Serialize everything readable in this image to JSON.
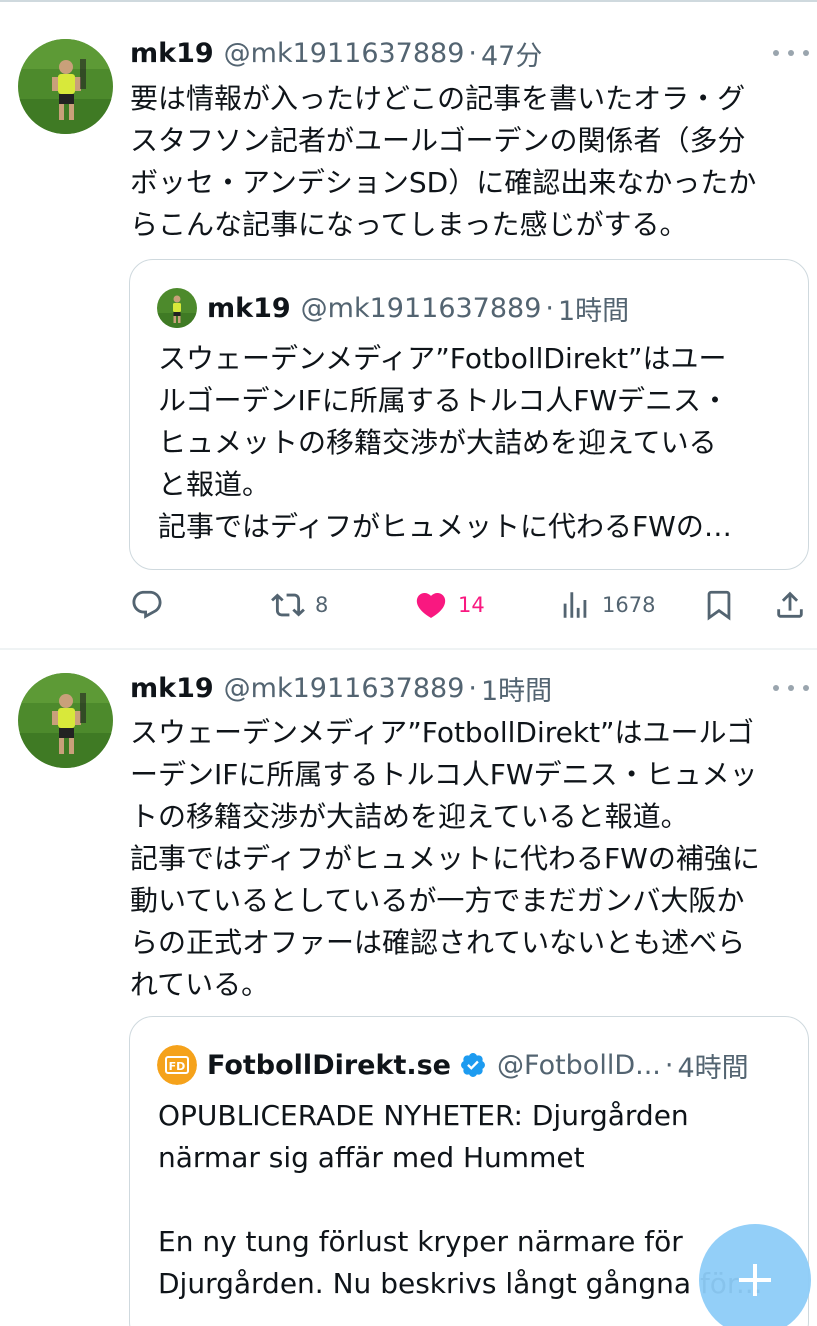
{
  "tweet1": {
    "name": "mk19",
    "handle": "@mk1911637889",
    "dot": "·",
    "time": "47分",
    "text_lines": [
      "要は情報が入ったけどこの記事を書いたオラ・グ",
      "スタフソン記者がユールゴーデンの関係者（多分",
      "ボッセ・アンデションSD）に確認出来なかったか",
      "らこんな記事になってしまった感じがする。"
    ],
    "quote": {
      "name": "mk19",
      "handle": "@mk1911637889",
      "dot": "·",
      "time": "1時間",
      "text_lines": [
        "スウェーデンメディア”FotbollDirekt”はユー",
        "ルゴーデンIFに所属するトルコ人FWデニス・",
        "ヒュメットの移籍交渉が大詰めを迎えている",
        "と報道。",
        "記事ではディフがヒュメットに代わるFWの…"
      ]
    },
    "actions": {
      "replies": "",
      "retweets": "8",
      "likes": "14",
      "views": "1678"
    },
    "like_color": "#f91880"
  },
  "tweet2": {
    "name": "mk19",
    "handle": "@mk1911637889",
    "dot": "·",
    "time": "1時間",
    "text_lines": [
      "スウェーデンメディア”FotbollDirekt”はユールゴ",
      "ーデンIFに所属するトルコ人FWデニス・ヒュメッ",
      "トの移籍交渉が大詰めを迎えていると報道。",
      "記事ではディフがヒュメットに代わるFWの補強に",
      "動いているとしているが一方でまだガンバ大阪か",
      "らの正式オファーは確認されていないとも述べら",
      "れている。"
    ],
    "quote": {
      "name": "FotbollDirekt.se",
      "handle": "@FotbollD...",
      "dot": "·",
      "time": "4時間",
      "logo_text": "FD",
      "text_lines": [
        "OPUBLICERADE NYHETER: Djurgården",
        "närmar sig affär med Hummet",
        "",
        "En ny tung förlust kryper närmare för",
        "Djurgården. Nu beskrivs långt gångna för..."
      ]
    }
  },
  "colors": {
    "text": "#0f1419",
    "secondary": "#536471",
    "border": "#cfd9de",
    "verified": "#1d9bf0",
    "fab": "#8ecdf8"
  },
  "icons": [
    "more-icon",
    "reply-icon",
    "retweet-icon",
    "like-icon",
    "views-icon",
    "bookmark-icon",
    "share-icon",
    "verified-badge-icon",
    "compose-plus-icon"
  ]
}
